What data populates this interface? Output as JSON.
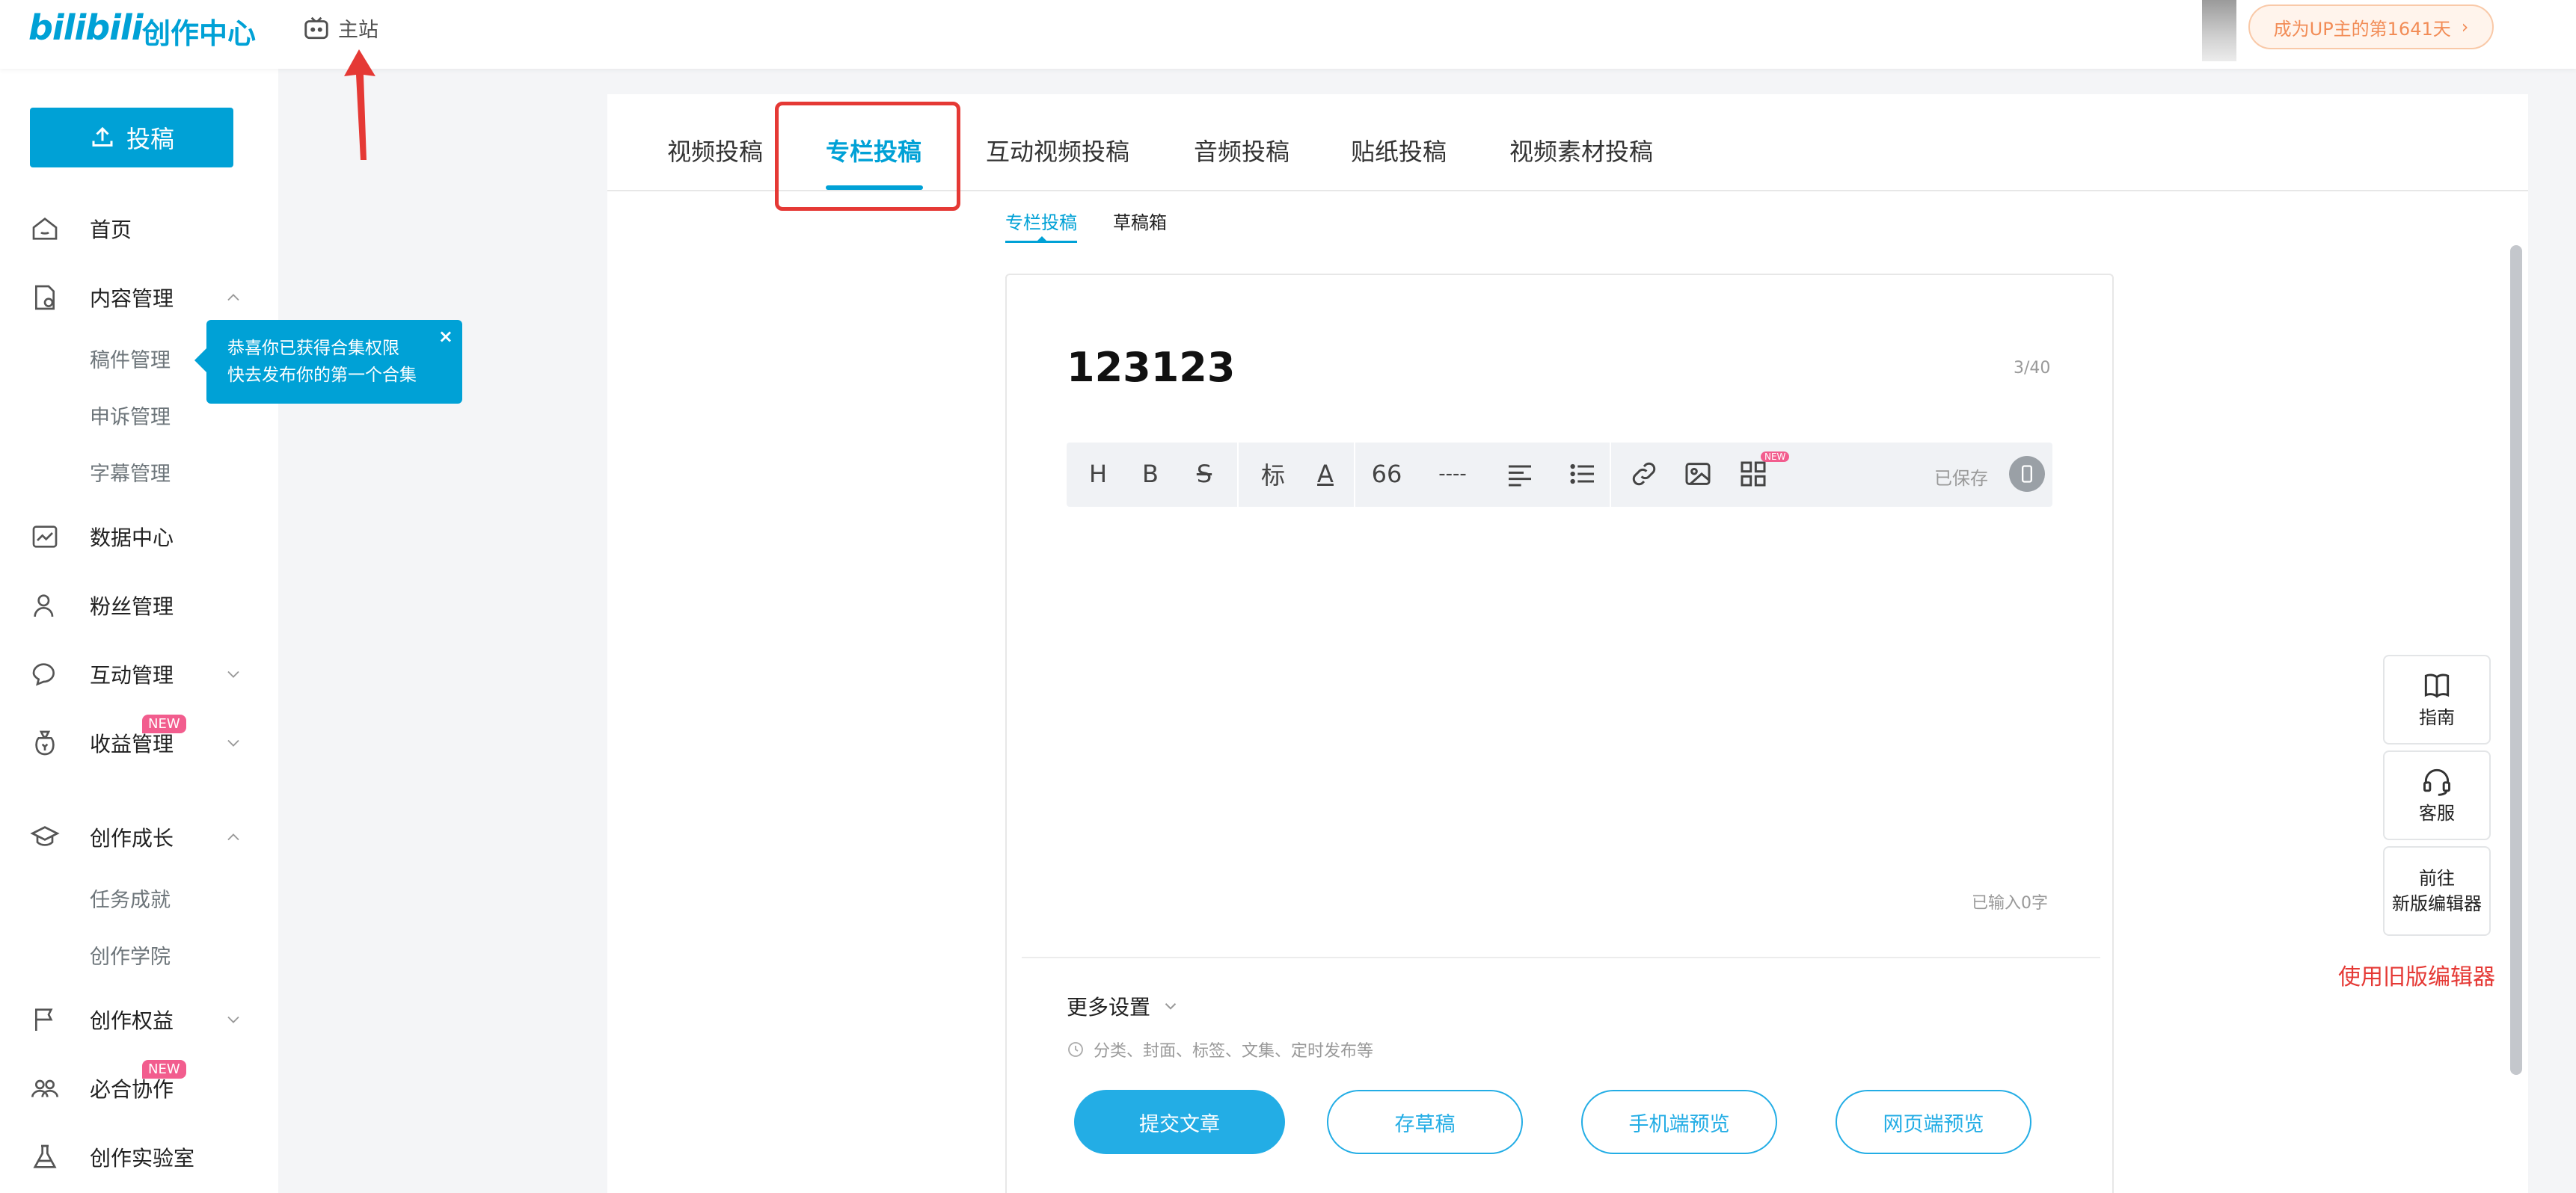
{
  "header": {
    "logo": "bilibili",
    "logo_sub": "创作中心",
    "home_link": "主站",
    "up_badge": "成为UP主的第1641天"
  },
  "sidebar": {
    "upload_label": "投稿",
    "items": [
      {
        "label": "首页"
      },
      {
        "label": "内容管理"
      },
      {
        "label": "数据中心"
      },
      {
        "label": "粉丝管理"
      },
      {
        "label": "互动管理"
      },
      {
        "label": "收益管理",
        "badge": "NEW"
      },
      {
        "label": "创作成长"
      },
      {
        "label": "创作权益"
      },
      {
        "label": "必合协作",
        "badge": "NEW"
      },
      {
        "label": "创作实验室"
      }
    ],
    "content_sub": [
      "稿件管理",
      "申诉管理",
      "字幕管理"
    ],
    "growth_sub": [
      "任务成就",
      "创作学院"
    ],
    "tooltip_line1": "恭喜你已获得合集权限",
    "tooltip_line2": "快去发布你的第一个合集",
    "tooltip_close": "×"
  },
  "tabs": [
    "视频投稿",
    "专栏投稿",
    "互动视频投稿",
    "音频投稿",
    "贴纸投稿",
    "视频素材投稿"
  ],
  "subtabs": [
    "专栏投稿",
    "草稿箱"
  ],
  "editor": {
    "title": "123123",
    "title_count": "3/40",
    "toolbar": {
      "h": "H",
      "b": "B",
      "s": "S",
      "biao": "标",
      "a": "A",
      "quote": "66",
      "hr": "----",
      "new_badge": "NEW",
      "saved": "已保存"
    },
    "char_count": "已输入0字",
    "more_settings": "更多设置",
    "more_hint": "分类、封面、标签、文集、定时发布等",
    "buttons": {
      "submit": "提交文章",
      "draft": "存草稿",
      "mobile_preview": "手机端预览",
      "web_preview": "网页端预览"
    }
  },
  "float": {
    "guide": "指南",
    "service": "客服",
    "new_editor_1": "前往",
    "new_editor_2": "新版编辑器"
  },
  "annotation": "使用旧版编辑器",
  "colors": {
    "accent": "#00a1d6",
    "button": "#23ade5",
    "annotation": "#e53935",
    "badge": "#f25d8e"
  }
}
